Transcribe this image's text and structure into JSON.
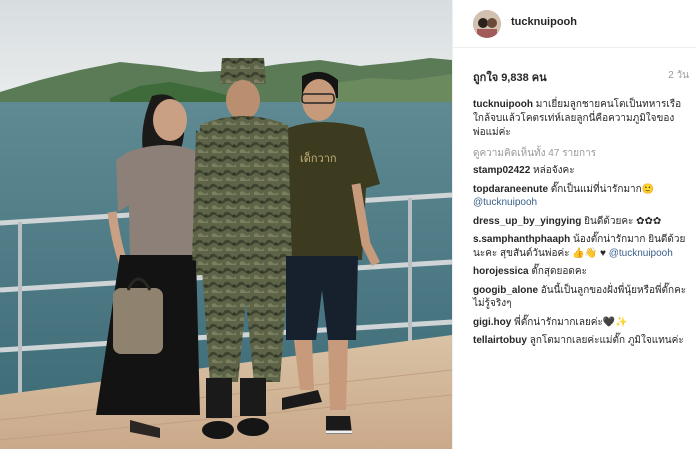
{
  "post": {
    "username": "tucknuipooh",
    "likes": "ถูกใจ 9,838 คน",
    "time": "2 วัน",
    "caption_user": "tucknuipooh",
    "caption_text": "มาเยี่ยมลูกชายคนโตเป็นทหารเรือใกล้จบแล้วโคตรเท่ห์เลยลูกนี่คือความภูมิใจของพ่อแม่ค่ะ",
    "view_all": "ดูความคิดเห็นทั้ง 47 รายการ"
  },
  "shirt_text": "เด็กวาก",
  "comments": [
    {
      "user": "stamp02422",
      "text": "หล่อจังคะ",
      "mention": ""
    },
    {
      "user": "topdaraneenute",
      "text": "ตั๊กเป็นแม่ที่น่ารักมาก🙂",
      "mention": "@tucknuipooh"
    },
    {
      "user": "dress_up_by_yingying",
      "text": "ยินดีด้วยคะ ✿✿✿",
      "mention": ""
    },
    {
      "user": "s.samphanthphaaph",
      "text": "น้องตั๊กน่ารักมาก ยินดีด้วยนะคะ สุขสันต์วันพ่อค่ะ 👍👋 ♥",
      "mention": "@tucknuipooh"
    },
    {
      "user": "horojessica",
      "text": "ตั๊กสุดยอดคะ",
      "mention": ""
    },
    {
      "user": "googib_alone",
      "text": "อันนี้เป็นลูกของฝั่งพี่นุ้ยหรือพี่ตั๊กคะ ไม่รู้จริงๆ",
      "mention": ""
    },
    {
      "user": "gigi.hoy",
      "text": "พี่ตั๊กน่ารักมากเลยค่ะ🖤✨",
      "mention": ""
    },
    {
      "user": "tellairtobuy",
      "text": "ลูกโตมากเลยค่ะแม่ตั๊ก ภูมิใจแทนค่ะ",
      "mention": ""
    }
  ]
}
